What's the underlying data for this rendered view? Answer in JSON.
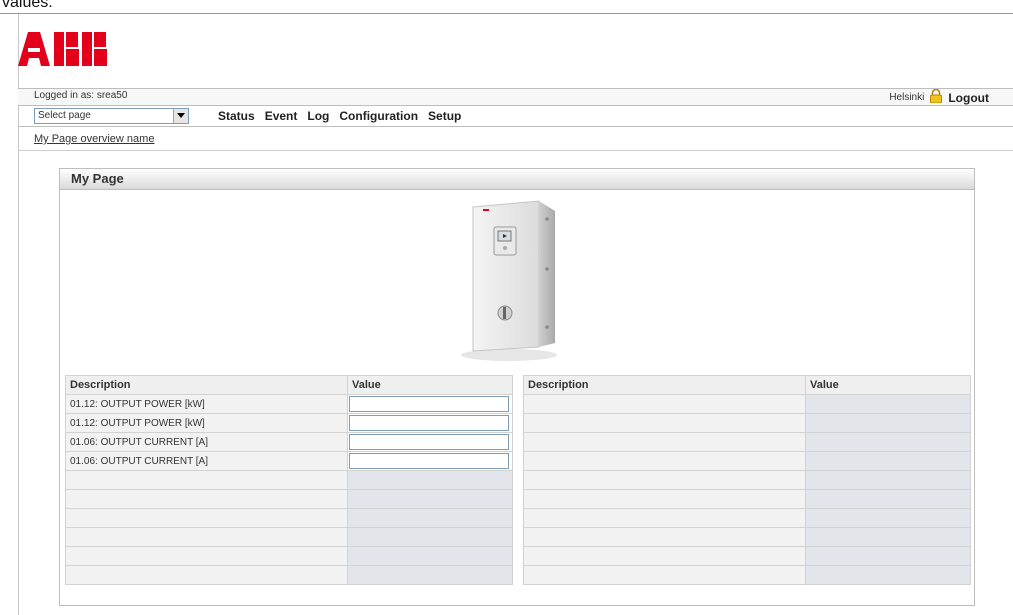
{
  "header": {
    "clipped_text": "values.",
    "logged_in_as": "Logged in as: srea50",
    "location": "Helsinki",
    "logout_label": "Logout"
  },
  "nav": {
    "select_placeholder": "Select page",
    "menu": [
      "Status",
      "Event",
      "Log",
      "Configuration",
      "Setup"
    ]
  },
  "breadcrumb": "My Page overview name",
  "panel": {
    "title": "My Page",
    "left_table": {
      "headers": [
        "Description",
        "Value"
      ],
      "rows": [
        {
          "desc": "01.12: OUTPUT POWER [kW]",
          "value": ""
        },
        {
          "desc": "01.12: OUTPUT POWER [kW]",
          "value": ""
        },
        {
          "desc": "01.06: OUTPUT CURRENT [A]",
          "value": ""
        },
        {
          "desc": "01.06: OUTPUT CURRENT [A]",
          "value": ""
        },
        {
          "desc": "",
          "value": ""
        },
        {
          "desc": "",
          "value": ""
        },
        {
          "desc": "",
          "value": ""
        },
        {
          "desc": "",
          "value": ""
        },
        {
          "desc": "",
          "value": ""
        },
        {
          "desc": "",
          "value": ""
        }
      ]
    },
    "right_table": {
      "headers": [
        "Description",
        "Value"
      ],
      "rows": [
        {
          "desc": "",
          "value": ""
        },
        {
          "desc": "",
          "value": ""
        },
        {
          "desc": "",
          "value": ""
        },
        {
          "desc": "",
          "value": ""
        },
        {
          "desc": "",
          "value": ""
        },
        {
          "desc": "",
          "value": ""
        },
        {
          "desc": "",
          "value": ""
        },
        {
          "desc": "",
          "value": ""
        },
        {
          "desc": "",
          "value": ""
        },
        {
          "desc": "",
          "value": ""
        }
      ]
    }
  },
  "colors": {
    "brand": "#e2001a",
    "value_cell": "#e2e6ea"
  },
  "icons": [
    "abb-logo",
    "lock-icon",
    "dropdown-arrow-icon",
    "drive-device-image"
  ]
}
